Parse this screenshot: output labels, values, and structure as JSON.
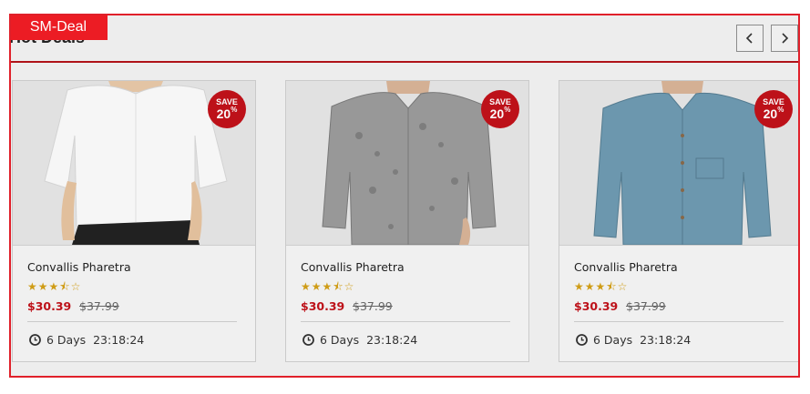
{
  "module_tag": "SM-Deal",
  "section": {
    "title": "Hot Deals"
  },
  "nav": {
    "prev_icon": "chevron-left-icon",
    "next_icon": "chevron-right-icon"
  },
  "colors": {
    "accent": "#ec1c24",
    "sale_badge": "#c1121a",
    "price": "#c1121a",
    "star": "#d4a017"
  },
  "products": [
    {
      "name": "Convallis Pharetra",
      "image": "white-blouse",
      "badge": {
        "label": "SAVE",
        "value": "20",
        "unit": "%"
      },
      "rating": 3.5,
      "stars": "★★★⯪☆",
      "price": "$30.39",
      "old_price": "$37.99",
      "countdown": {
        "days": "6 Days",
        "time": "23:18:24"
      }
    },
    {
      "name": "Convallis Pharetra",
      "image": "grey-patterned-shirt",
      "badge": {
        "label": "SAVE",
        "value": "20",
        "unit": "%"
      },
      "rating": 3.5,
      "stars": "★★★⯪☆",
      "price": "$30.39",
      "old_price": "$37.99",
      "countdown": {
        "days": "6 Days",
        "time": "23:18:24"
      }
    },
    {
      "name": "Convallis Pharetra",
      "image": "blue-denim-shirt",
      "badge": {
        "label": "SAVE",
        "value": "20",
        "unit": "%"
      },
      "rating": 3.5,
      "stars": "★★★⯪☆",
      "price": "$30.39",
      "old_price": "$37.99",
      "countdown": {
        "days": "6 Days",
        "time": "23:18:24"
      }
    }
  ]
}
